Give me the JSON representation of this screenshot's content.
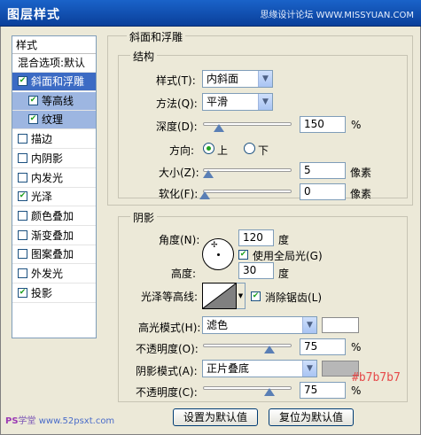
{
  "window": {
    "title": "图层样式",
    "brand": "思缘设计论坛 WWW.MISSYUAN.COM"
  },
  "sidebar": {
    "header": "样式",
    "blend": "混合选项:默认",
    "items": [
      {
        "label": "斜面和浮雕",
        "checked": true,
        "state": "selected"
      },
      {
        "label": "等高线",
        "checked": true,
        "state": "sub"
      },
      {
        "label": "纹理",
        "checked": true,
        "state": "sub"
      },
      {
        "label": "描边",
        "checked": false,
        "state": ""
      },
      {
        "label": "内阴影",
        "checked": false,
        "state": ""
      },
      {
        "label": "内发光",
        "checked": false,
        "state": ""
      },
      {
        "label": "光泽",
        "checked": true,
        "state": ""
      },
      {
        "label": "颜色叠加",
        "checked": false,
        "state": ""
      },
      {
        "label": "渐变叠加",
        "checked": false,
        "state": ""
      },
      {
        "label": "图案叠加",
        "checked": false,
        "state": ""
      },
      {
        "label": "外发光",
        "checked": false,
        "state": ""
      },
      {
        "label": "投影",
        "checked": true,
        "state": ""
      }
    ]
  },
  "bevel": {
    "group_title": "斜面和浮雕",
    "structure_title": "结构",
    "style_label": "样式(T):",
    "style_value": "内斜面",
    "technique_label": "方法(Q):",
    "technique_value": "平滑",
    "depth_label": "深度(D):",
    "depth_value": "150",
    "depth_unit": "%",
    "direction_label": "方向:",
    "direction_up": "上",
    "direction_down": "下",
    "size_label": "大小(Z):",
    "size_value": "5",
    "size_unit": "像素",
    "soften_label": "软化(F):",
    "soften_value": "0",
    "soften_unit": "像素"
  },
  "shading": {
    "title": "阴影",
    "angle_label": "角度(N):",
    "angle_value": "120",
    "angle_unit": "度",
    "global_light_label": "使用全局光(G)",
    "altitude_label": "高度:",
    "altitude_value": "30",
    "altitude_unit": "度",
    "gloss_label": "光泽等高线:",
    "antialias_label": "消除锯齿(L)",
    "highlight_mode_label": "高光模式(H):",
    "highlight_mode_value": "滤色",
    "highlight_opacity_label": "不透明度(O):",
    "highlight_opacity_value": "75",
    "highlight_opacity_unit": "%",
    "shadow_mode_label": "阴影模式(A):",
    "shadow_mode_value": "正片叠底",
    "shadow_opacity_label": "不透明度(C):",
    "shadow_opacity_value": "75",
    "shadow_opacity_unit": "%",
    "highlight_color": "#ffffff",
    "shadow_color": "#b7b7b7",
    "hex_annotation": "#b7b7b7"
  },
  "buttons": {
    "make_default": "设置为默认值",
    "reset_default": "复位为默认值"
  },
  "watermark": {
    "ps": "PS",
    "text": "学堂",
    "site": "www.52psxt.com"
  }
}
